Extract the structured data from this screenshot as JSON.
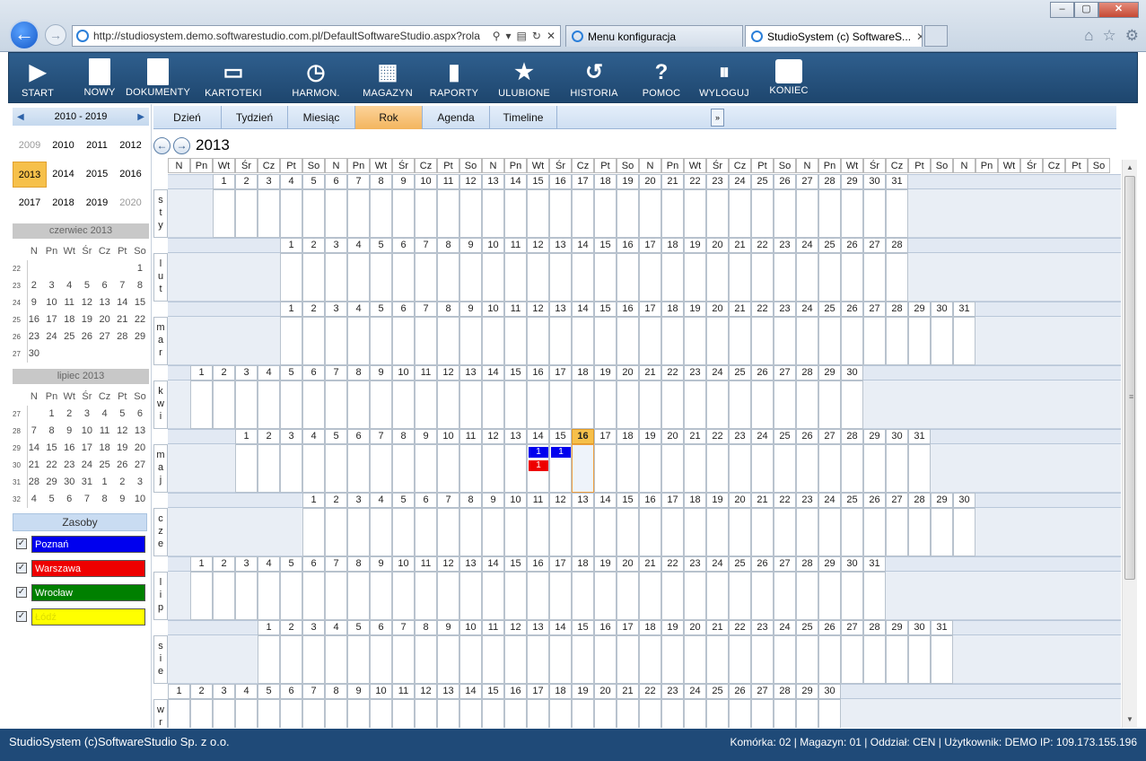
{
  "browser": {
    "url": "http://studiosystem.demo.softwarestudio.com.pl/DefaultSoftwareStudio.aspx?rola",
    "tabs": [
      {
        "label": "Menu konfiguracja"
      },
      {
        "label": "StudioSystem (c) SoftwareS..."
      }
    ]
  },
  "toolbar": [
    {
      "label": "START",
      "icon": "play-icon"
    },
    {
      "label": "NOWY",
      "icon": "new-document-icon"
    },
    {
      "label": "DOKUMENTY",
      "icon": "documents-icon"
    },
    {
      "label": "KARTOTEKI",
      "icon": "card-index-icon"
    },
    {
      "label": "HARMON.",
      "icon": "schedule-clock-icon"
    },
    {
      "label": "MAGAZYN",
      "icon": "warehouse-grid-icon"
    },
    {
      "label": "RAPORTY",
      "icon": "reports-chart-icon"
    },
    {
      "label": "ULUBIONE",
      "icon": "favorites-star-icon"
    },
    {
      "label": "HISTORIA",
      "icon": "history-icon"
    },
    {
      "label": "POMOC",
      "icon": "help-icon"
    },
    {
      "label": "WYLOGUJ",
      "icon": "logout-icon"
    },
    {
      "label": "KONIEC",
      "icon": "exit-icon"
    }
  ],
  "year_nav": {
    "range": "2010 - 2019",
    "years": [
      "2009",
      "2010",
      "2011",
      "2012",
      "2013",
      "2014",
      "2015",
      "2016",
      "2017",
      "2018",
      "2019",
      "2020"
    ],
    "selected": "2013"
  },
  "mini_cal1": {
    "title": "czerwiec 2013",
    "headers": [
      "N",
      "Pn",
      "Wt",
      "Śr",
      "Cz",
      "Pt",
      "So"
    ],
    "rows": [
      {
        "wk": "22",
        "days": [
          "",
          "",
          "",
          "",
          "",
          "",
          "1"
        ]
      },
      {
        "wk": "23",
        "days": [
          "2",
          "3",
          "4",
          "5",
          "6",
          "7",
          "8"
        ]
      },
      {
        "wk": "24",
        "days": [
          "9",
          "10",
          "11",
          "12",
          "13",
          "14",
          "15"
        ]
      },
      {
        "wk": "25",
        "days": [
          "16",
          "17",
          "18",
          "19",
          "20",
          "21",
          "22"
        ]
      },
      {
        "wk": "26",
        "days": [
          "23",
          "24",
          "25",
          "26",
          "27",
          "28",
          "29"
        ]
      },
      {
        "wk": "27",
        "days": [
          "30",
          "",
          "",
          "",
          "",
          "",
          ""
        ]
      }
    ]
  },
  "mini_cal2": {
    "title": "lipiec 2013",
    "headers": [
      "N",
      "Pn",
      "Wt",
      "Śr",
      "Cz",
      "Pt",
      "So"
    ],
    "rows": [
      {
        "wk": "27",
        "days": [
          "",
          "1",
          "2",
          "3",
          "4",
          "5",
          "6"
        ]
      },
      {
        "wk": "28",
        "days": [
          "7",
          "8",
          "9",
          "10",
          "11",
          "12",
          "13"
        ]
      },
      {
        "wk": "29",
        "days": [
          "14",
          "15",
          "16",
          "17",
          "18",
          "19",
          "20"
        ]
      },
      {
        "wk": "30",
        "days": [
          "21",
          "22",
          "23",
          "24",
          "25",
          "26",
          "27"
        ]
      },
      {
        "wk": "31",
        "days": [
          "28",
          "29",
          "30",
          "31",
          "1",
          "2",
          "3"
        ]
      },
      {
        "wk": "32",
        "days": [
          "4",
          "5",
          "6",
          "7",
          "8",
          "9",
          "10"
        ]
      }
    ]
  },
  "resources": {
    "title": "Zasoby",
    "items": [
      {
        "label": "Poznań",
        "color": "#0000ee",
        "text_color": "#ffffff"
      },
      {
        "label": "Warszawa",
        "color": "#ee0000",
        "text_color": "#ffffff"
      },
      {
        "label": "Wrocław",
        "color": "#008000",
        "text_color": "#ffffff"
      },
      {
        "label": "Łódź",
        "color": "#ffff00",
        "text_color": "#dddd00"
      }
    ]
  },
  "view_tabs": [
    "Dzień",
    "Tydzień",
    "Miesiąc",
    "Rok",
    "Agenda",
    "Timeline"
  ],
  "selected_view": "Rok",
  "year_title": "2013",
  "day_headers": [
    "N",
    "Pn",
    "Wt",
    "Śr",
    "Cz",
    "Pt",
    "So",
    "N",
    "Pn",
    "Wt",
    "Śr",
    "Cz",
    "Pt",
    "So",
    "N",
    "Pn",
    "Wt",
    "Śr",
    "Cz",
    "Pt",
    "So",
    "N",
    "Pn",
    "Wt",
    "Śr",
    "Cz",
    "Pt",
    "So",
    "N",
    "Pn",
    "Wt",
    "Śr",
    "Cz",
    "Pt",
    "So",
    "N",
    "Pn",
    "Wt",
    "Śr",
    "Cz",
    "Pt",
    "So"
  ],
  "months": [
    {
      "label": "sty",
      "offset": 2,
      "days": 31
    },
    {
      "label": "lut",
      "offset": 5,
      "days": 28
    },
    {
      "label": "mar",
      "offset": 5,
      "days": 31
    },
    {
      "label": "kwi",
      "offset": 1,
      "days": 30
    },
    {
      "label": "maj",
      "offset": 3,
      "days": 31
    },
    {
      "label": "cze",
      "offset": 6,
      "days": 30
    },
    {
      "label": "lip",
      "offset": 1,
      "days": 31
    },
    {
      "label": "sie",
      "offset": 4,
      "days": 31
    },
    {
      "label": "wrz",
      "offset": 0,
      "days": 30
    }
  ],
  "today": {
    "month": 4,
    "day": 16
  },
  "events": [
    {
      "month": 4,
      "day": 14,
      "slot": 0,
      "text": "1",
      "color": "#0000ee"
    },
    {
      "month": 4,
      "day": 15,
      "slot": 0,
      "text": "1",
      "color": "#0000ee"
    },
    {
      "month": 4,
      "day": 14,
      "slot": 1,
      "text": "1",
      "color": "#ee0000"
    }
  ],
  "status": {
    "left": "StudioSystem (c)SoftwareStudio Sp. z o.o.",
    "right": "Komórka: 02 | Magazyn: 01 | Oddział: CEN | Użytkownik: DEMO IP: 109.173.155.196"
  }
}
